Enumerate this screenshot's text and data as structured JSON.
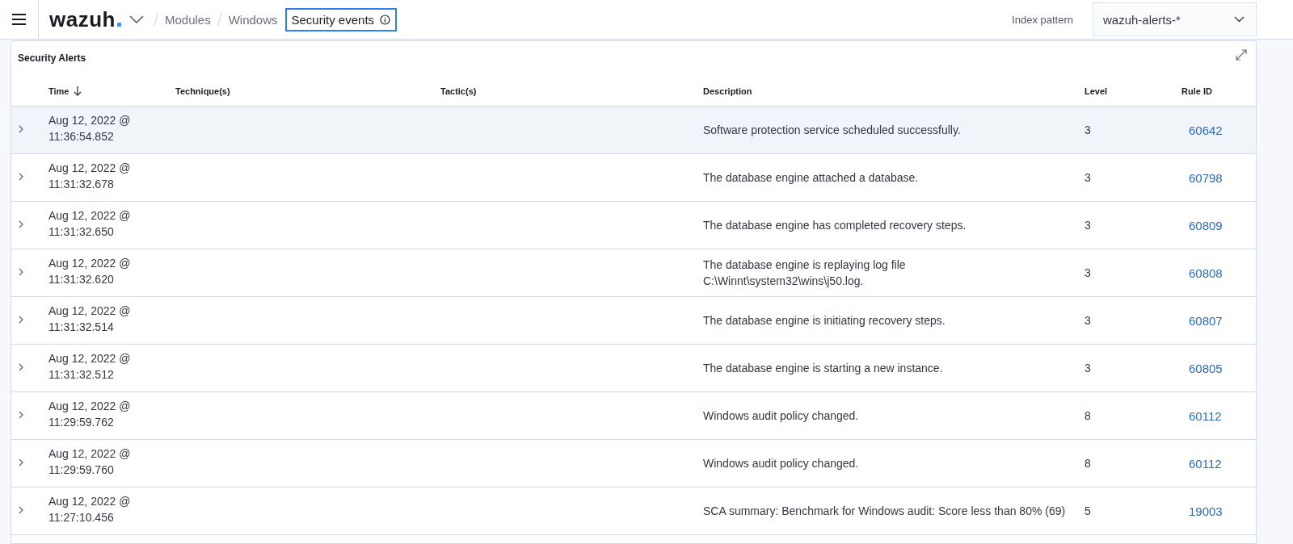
{
  "header": {
    "logo": "wazuh",
    "breadcrumbs": [
      "Modules",
      "Windows"
    ],
    "current": "Security events",
    "index_pattern": {
      "label": "Index pattern",
      "value": "wazuh-alerts-*"
    }
  },
  "panel": {
    "title": "Security Alerts",
    "columns": [
      {
        "label": "Time",
        "sorted": true
      },
      {
        "label": "Technique(s)",
        "sorted": false
      },
      {
        "label": "Tactic(s)",
        "sorted": false
      },
      {
        "label": "Description",
        "sorted": false
      },
      {
        "label": "Level",
        "sorted": false
      },
      {
        "label": "Rule ID",
        "sorted": false
      }
    ],
    "rows": [
      {
        "date": "Aug 12, 2022 @",
        "time": "11:36:54.852",
        "description": "Software protection service scheduled successfully.",
        "level": "3",
        "rule_id": "60642",
        "selected": true
      },
      {
        "date": "Aug 12, 2022 @",
        "time": "11:31:32.678",
        "description": "The database engine attached a database.",
        "level": "3",
        "rule_id": "60798",
        "selected": false
      },
      {
        "date": "Aug 12, 2022 @",
        "time": "11:31:32.650",
        "description": "The database engine has completed recovery steps.",
        "level": "3",
        "rule_id": "60809",
        "selected": false
      },
      {
        "date": "Aug 12, 2022 @",
        "time": "11:31:32.620",
        "description": "The database engine is replaying log file C:\\Winnt\\system32\\wins\\j50.log.",
        "level": "3",
        "rule_id": "60808",
        "selected": false
      },
      {
        "date": "Aug 12, 2022 @",
        "time": "11:31:32.514",
        "description": "The database engine is initiating recovery steps.",
        "level": "3",
        "rule_id": "60807",
        "selected": false
      },
      {
        "date": "Aug 12, 2022 @",
        "time": "11:31:32.512",
        "description": "The database engine is starting a new instance.",
        "level": "3",
        "rule_id": "60805",
        "selected": false
      },
      {
        "date": "Aug 12, 2022 @",
        "time": "11:29:59.762",
        "description": "Windows audit policy changed.",
        "level": "8",
        "rule_id": "60112",
        "selected": false
      },
      {
        "date": "Aug 12, 2022 @",
        "time": "11:29:59.760",
        "description": "Windows audit policy changed.",
        "level": "8",
        "rule_id": "60112",
        "selected": false
      },
      {
        "date": "Aug 12, 2022 @",
        "time": "11:27:10.456",
        "description": "SCA summary: Benchmark for Windows audit: Score less than 80% (69)",
        "level": "5",
        "rule_id": "19003",
        "selected": false
      }
    ]
  }
}
